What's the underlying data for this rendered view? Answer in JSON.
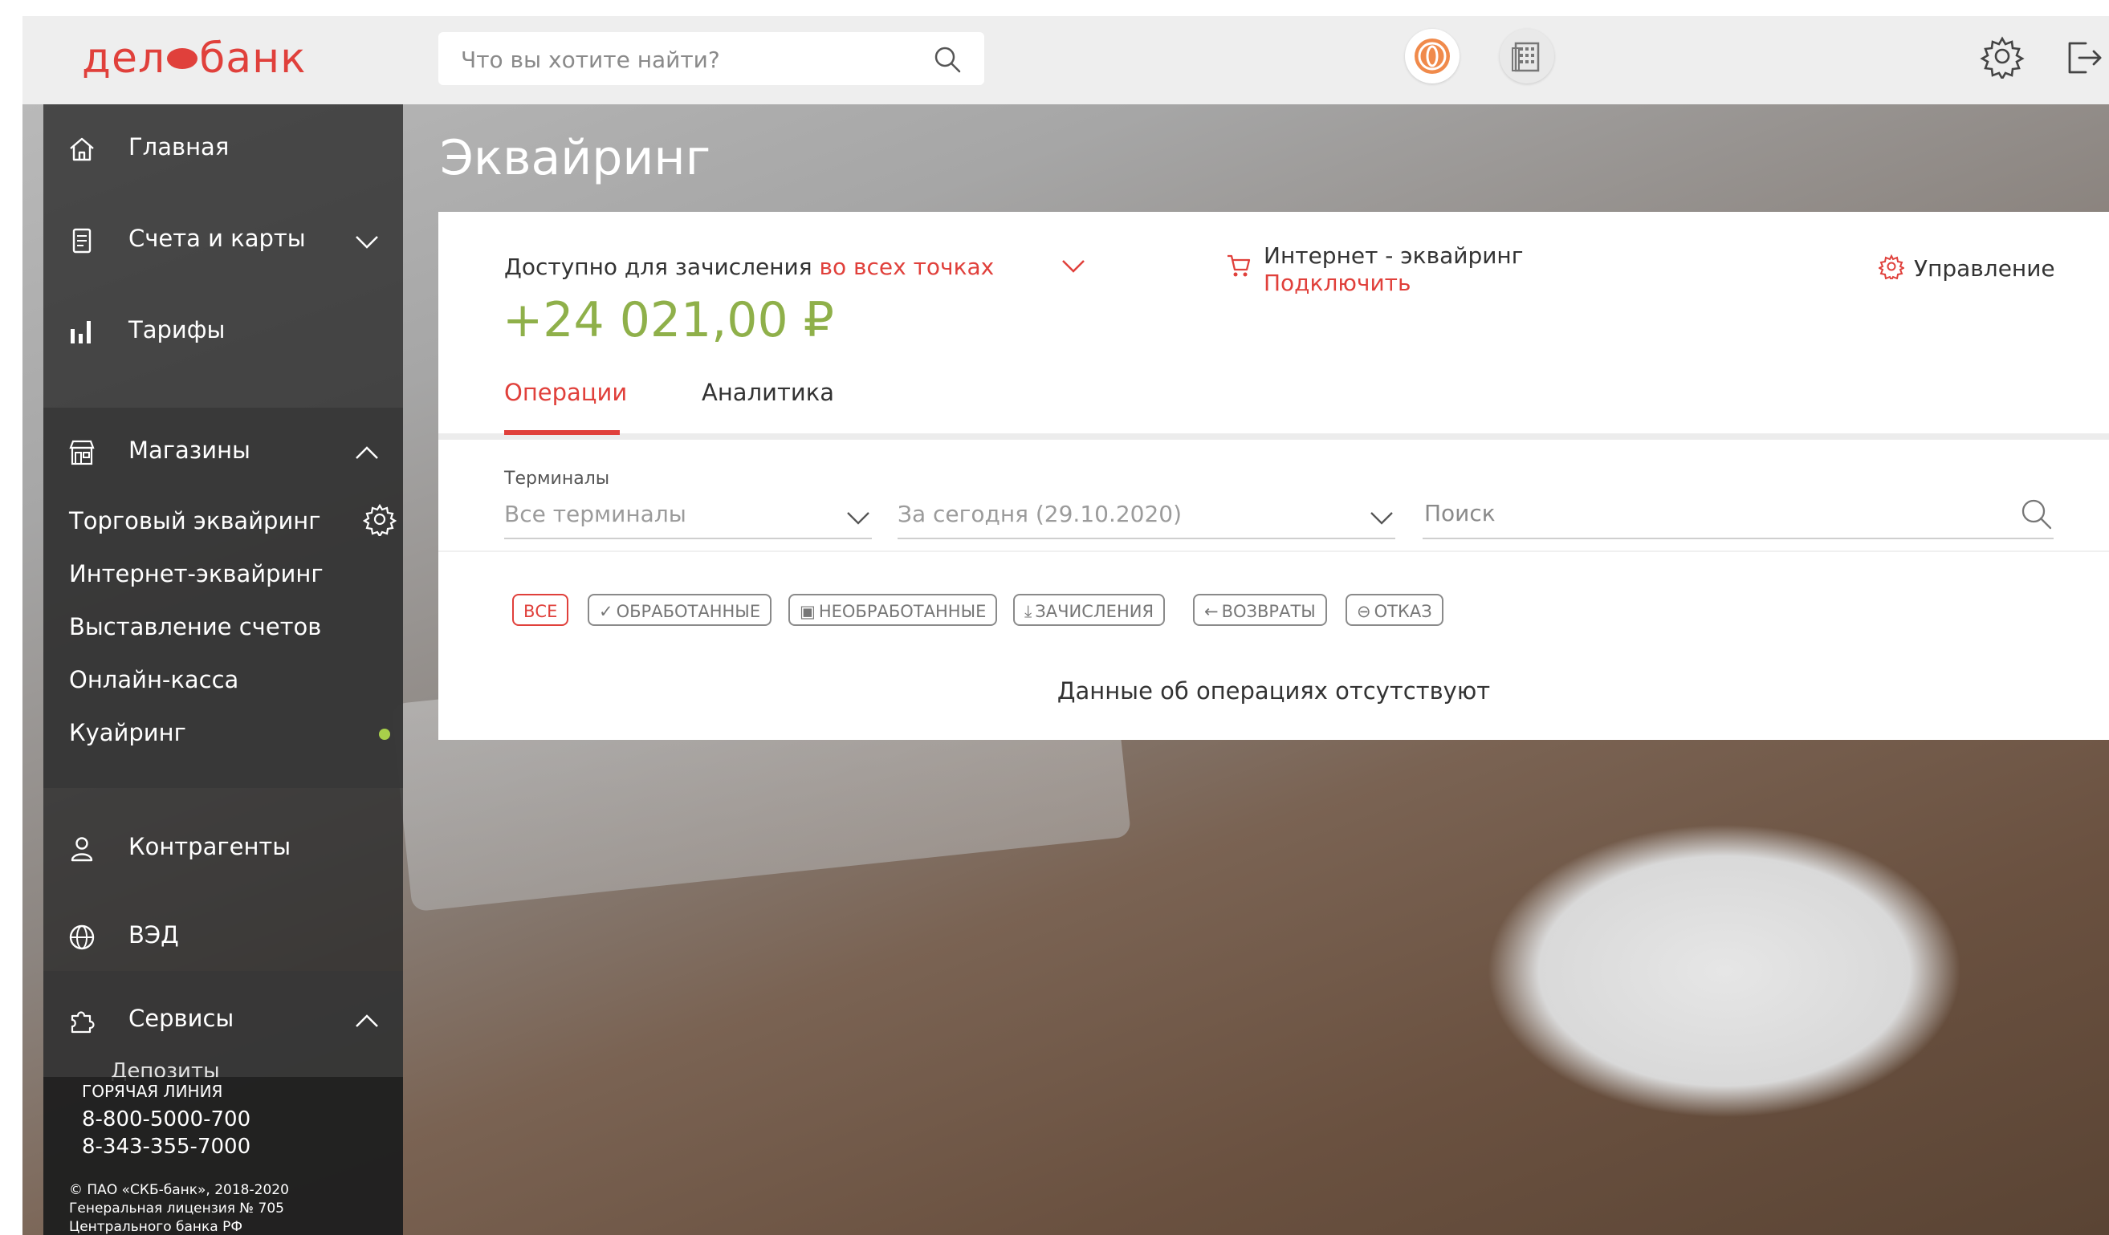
{
  "brand": {
    "logo_left": "дел",
    "logo_right": "банк",
    "accent": "#e0403b"
  },
  "search": {
    "placeholder": "Что вы хотите найти?"
  },
  "header_icons": [
    "coin-icon",
    "building-icon",
    "gear-icon",
    "logout-icon"
  ],
  "sidebar": {
    "items": [
      {
        "label": "Главная",
        "icon": "home-icon"
      },
      {
        "label": "Счета и карты",
        "icon": "document-icon"
      },
      {
        "label": "Тарифы",
        "icon": "bar-chart-icon"
      },
      {
        "label": "Магазины",
        "icon": "store-icon"
      },
      {
        "label": "Контрагенты",
        "icon": "user-icon"
      },
      {
        "label": "ВЭД",
        "icon": "globe-icon"
      },
      {
        "label": "Сервисы",
        "icon": "puzzle-icon"
      }
    ],
    "shops_sub": [
      "Торговый эквайринг",
      "Интернет-эквайринг",
      "Выставление счетов",
      "Онлайн-касса",
      "Куайринг"
    ],
    "services_peek": "Депозиты",
    "hotline": {
      "title": "ГОРЯЧАЯ ЛИНИЯ",
      "phone1": "8-800-5000-700",
      "phone2": "8-343-355-7000",
      "copyright": "© ПАО «СКБ-банк», 2018-2020",
      "license": "Генеральная лицензия № 705",
      "cb": "Центрального банка РФ"
    }
  },
  "page": {
    "title": "Эквайринг"
  },
  "summary": {
    "available_label": "Доступно для зачисления",
    "available_scope": "во всех точках",
    "amount_int": "+24 021",
    "amount_dec": ",00",
    "currency": "₽",
    "internet_title": "Интернет - эквайринг",
    "internet_link": "Подключить",
    "manage": "Управление"
  },
  "tabs": [
    {
      "label": "Операции",
      "active": true
    },
    {
      "label": "Аналитика",
      "active": false
    }
  ],
  "filters": {
    "terminals_label": "Терминалы",
    "terminals_value": "Все терминалы",
    "period_value": "За сегодня (29.10.2020)",
    "search_placeholder": "Поиск"
  },
  "chips": [
    {
      "label": "ВСЕ",
      "icon": ""
    },
    {
      "label": "ОБРАБОТАННЫЕ",
      "icon": "check-icon"
    },
    {
      "label": "НЕОБРАБОТАННЫЕ",
      "icon": "card-icon"
    },
    {
      "label": "ЗАЧИСЛЕНИЯ",
      "icon": "download-icon"
    },
    {
      "label": "ВОЗВРАТЫ",
      "icon": "arrow-left-icon"
    },
    {
      "label": "ОТКАЗ",
      "icon": "minus-circle-icon"
    }
  ],
  "empty_message": "Данные об операциях отсутствуют"
}
